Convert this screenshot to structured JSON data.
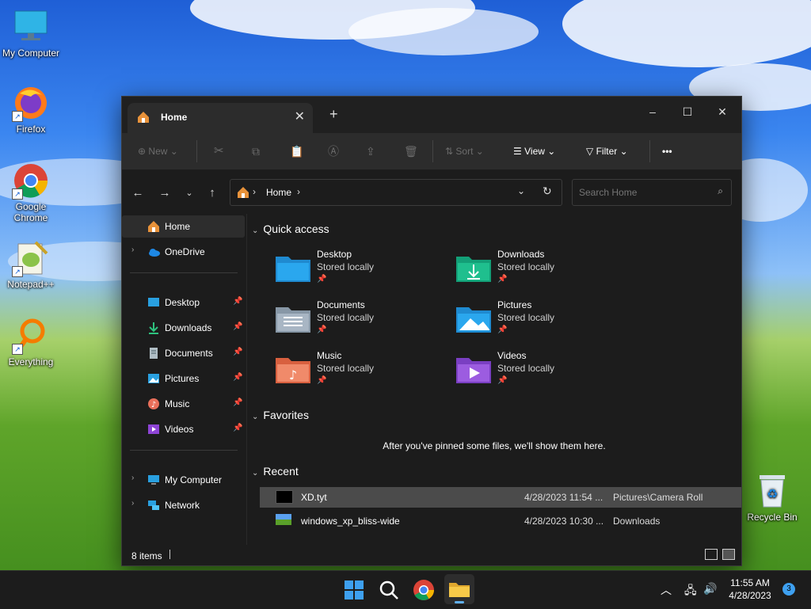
{
  "desktop": {
    "icons": [
      {
        "label": "My Computer"
      },
      {
        "label": "Firefox"
      },
      {
        "label": "Google Chrome"
      },
      {
        "label": "Notepad++"
      },
      {
        "label": "Everything"
      },
      {
        "label": "Recycle Bin"
      }
    ]
  },
  "explorer": {
    "tab_title": "Home",
    "window_controls": {
      "minimize": "–",
      "maximize": "☐",
      "close": "✕"
    },
    "new_tab": "+",
    "tab_close": "✕",
    "toolbar": {
      "new_label": "New",
      "sort_label": "Sort",
      "view_label": "View",
      "filter_label": "Filter",
      "more_label": "•••"
    },
    "address": {
      "path_root": "Home",
      "search_placeholder": "Search Home"
    },
    "sidebar": {
      "home": "Home",
      "onedrive": "OneDrive",
      "pinned": [
        {
          "label": "Desktop"
        },
        {
          "label": "Downloads"
        },
        {
          "label": "Documents"
        },
        {
          "label": "Pictures"
        },
        {
          "label": "Music"
        },
        {
          "label": "Videos"
        }
      ],
      "my_computer": "My Computer",
      "network": "Network"
    },
    "quick_access": {
      "heading": "Quick access",
      "items": [
        {
          "name": "Desktop",
          "sub": "Stored locally"
        },
        {
          "name": "Downloads",
          "sub": "Stored locally"
        },
        {
          "name": "Documents",
          "sub": "Stored locally"
        },
        {
          "name": "Pictures",
          "sub": "Stored locally"
        },
        {
          "name": "Music",
          "sub": "Stored locally"
        },
        {
          "name": "Videos",
          "sub": "Stored locally"
        }
      ]
    },
    "favorites": {
      "heading": "Favorites",
      "empty_message": "After you've pinned some files, we'll show them here."
    },
    "recent": {
      "heading": "Recent",
      "rows": [
        {
          "name": "XD.tyt",
          "date": "4/28/2023 11:54 ...",
          "location": "Pictures\\Camera Roll"
        },
        {
          "name": "windows_xp_bliss-wide",
          "date": "4/28/2023 10:30 ...",
          "location": "Downloads"
        }
      ]
    },
    "status": {
      "item_count": "8 items"
    }
  },
  "taskbar": {
    "time": "11:55 AM",
    "date": "4/28/2023",
    "notification_count": "3"
  }
}
